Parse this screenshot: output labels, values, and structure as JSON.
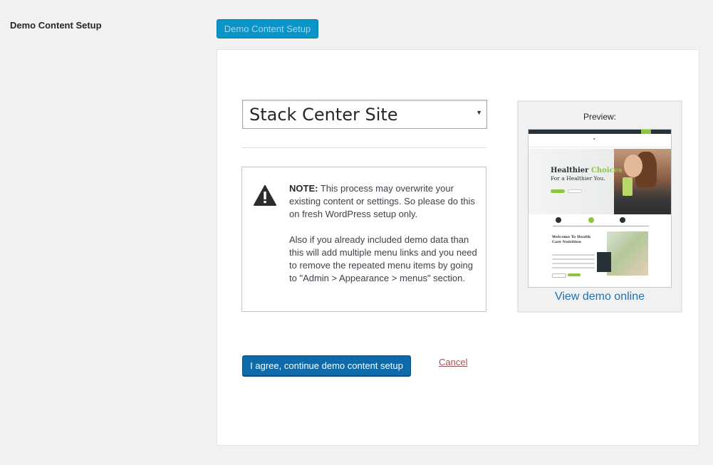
{
  "section": {
    "label": "Demo Content Setup"
  },
  "top_button": {
    "label": "Demo Content Setup"
  },
  "site_select": {
    "selected": "Stack Center Site"
  },
  "note": {
    "title": "NOTE:",
    "text1": "This process may overwrite your existing content or settings. So please do this on fresh WordPress setup only.",
    "text2": "Also if you already included demo data than this will add multiple menu links and you need to remove the repeated menu items by going to \"Admin > Appearance > menus\" section.",
    "icon": "warning-icon"
  },
  "preview": {
    "label": "Preview:",
    "view_demo_link": "View demo online"
  },
  "actions": {
    "agree_button": "I agree, continue demo content setup",
    "cancel_link": "Cancel"
  },
  "colors": {
    "primary_button": "#0e6aa8",
    "top_button": "#0a95c9",
    "link": "#2271b1",
    "cancel": "#a0525a",
    "thumbnail_accent": "#8cc63f"
  }
}
